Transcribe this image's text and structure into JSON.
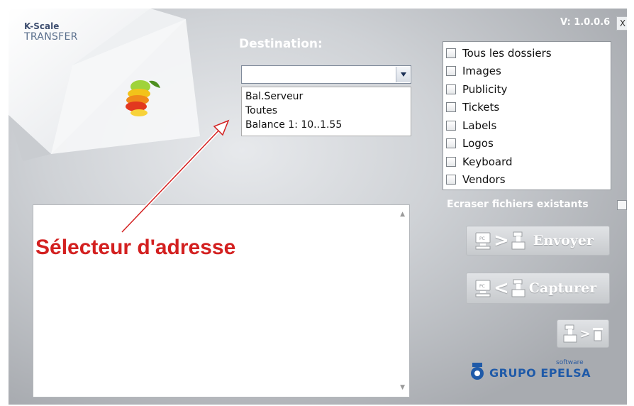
{
  "app": {
    "brand_line1": "K-Scale",
    "brand_line2": "TRANSFER",
    "version": "V: 1.0.0.6",
    "close_label": "X"
  },
  "destination": {
    "label": "Destination:",
    "value": "",
    "options": [
      "Bal.Serveur",
      "Toutes",
      "Balance 1: 10..1.55"
    ]
  },
  "folders": {
    "items": [
      {
        "label": "Tous les dossiers",
        "checked": false
      },
      {
        "label": "Images",
        "checked": false
      },
      {
        "label": "Publicity",
        "checked": false
      },
      {
        "label": "Tickets",
        "checked": false
      },
      {
        "label": "Labels",
        "checked": false
      },
      {
        "label": "Logos",
        "checked": false
      },
      {
        "label": "Keyboard",
        "checked": false
      },
      {
        "label": "Vendors",
        "checked": false
      }
    ]
  },
  "overwrite": {
    "label": "Ecraser fichiers existants",
    "checked": false
  },
  "actions": {
    "send_label": "Envoyer",
    "capture_label": "Capturer"
  },
  "annotation": {
    "text": "Sélecteur d'adresse",
    "color": "#d32020"
  },
  "footer": {
    "logo_small": "software",
    "logo_text": "GRUPO EPELSA"
  },
  "icons": {
    "dropdown": "chevron-down-icon",
    "pc": "pc-icon",
    "scale": "scale-icon",
    "trash": "trash-icon",
    "fruit": "fruit-logo-icon"
  }
}
